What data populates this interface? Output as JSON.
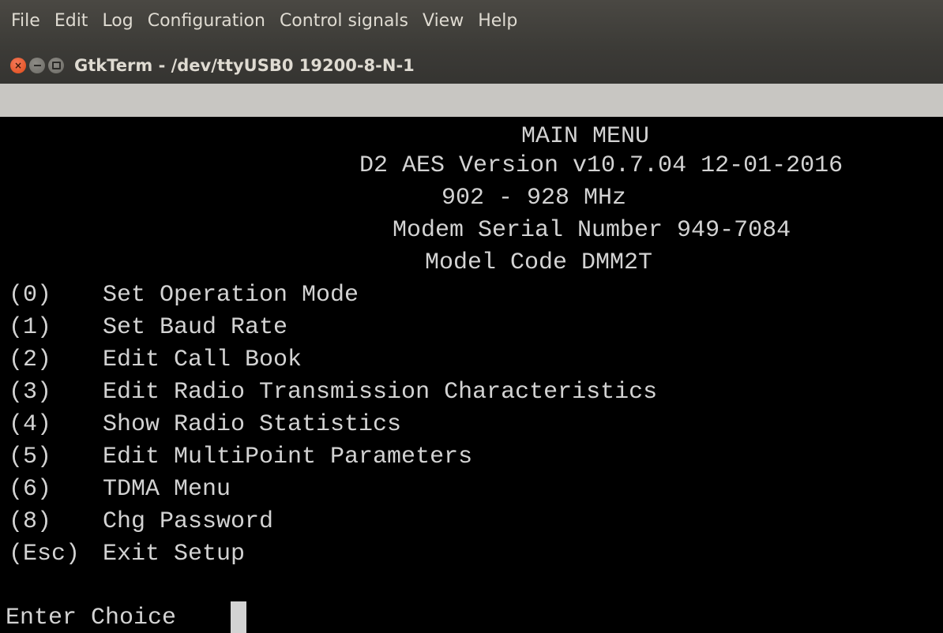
{
  "menubar": {
    "items": [
      "File",
      "Edit",
      "Log",
      "Configuration",
      "Control signals",
      "View",
      "Help"
    ]
  },
  "window": {
    "title": "GtkTerm - /dev/ttyUSB0  19200-8-N-1"
  },
  "terminal": {
    "header": {
      "title": "MAIN MENU",
      "version": "D2 AES Version v10.7.04 12-01-2016",
      "frequency": "902 - 928 MHz",
      "serial": "Modem Serial Number 949-7084",
      "model": "Model Code DMM2T"
    },
    "menu": [
      {
        "key": "(0)",
        "label": "Set Operation Mode"
      },
      {
        "key": "(1)",
        "label": "Set Baud Rate"
      },
      {
        "key": "(2)",
        "label": "Edit Call Book"
      },
      {
        "key": "(3)",
        "label": "Edit Radio Transmission Characteristics"
      },
      {
        "key": "(4)",
        "label": "Show Radio Statistics"
      },
      {
        "key": "(5)",
        "label": "Edit MultiPoint Parameters"
      },
      {
        "key": "(6)",
        "label": "TDMA Menu"
      },
      {
        "key": "(8)",
        "label": "Chg Password"
      },
      {
        "key": "(Esc)",
        "label": "Exit Setup"
      }
    ],
    "prompt": "Enter Choice"
  },
  "colors": {
    "terminal_bg": "#000000",
    "terminal_fg": "#d3d3d3",
    "titlebar_bg": "#3c3b37",
    "close_button": "#df4a16"
  },
  "icons": {
    "close": "close-icon",
    "minimize": "minimize-icon",
    "maximize": "maximize-icon"
  }
}
